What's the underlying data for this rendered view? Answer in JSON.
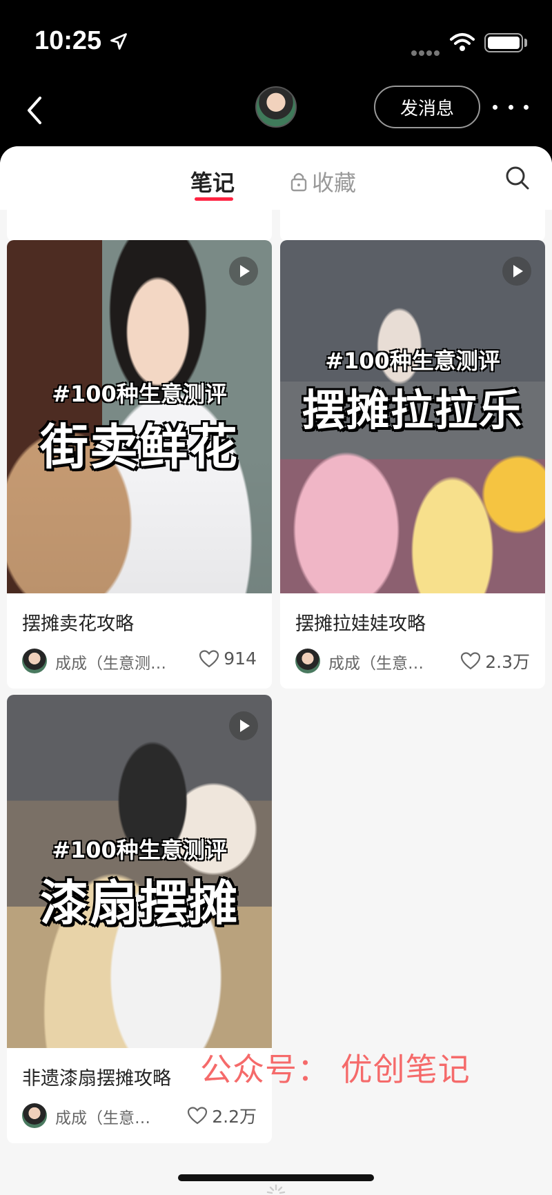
{
  "status_bar": {
    "time": "10:25"
  },
  "header": {
    "message_button": "发消息"
  },
  "tabs": {
    "notes": "笔记",
    "collections": "收藏"
  },
  "notes": [
    {
      "cover_tag": "#100种生意测评",
      "cover_title": "街卖鲜花",
      "title": "摆摊卖花攻略",
      "author": "成成（生意测…",
      "likes": "914"
    },
    {
      "cover_tag": "#100种生意测评",
      "cover_title": "摆摊拉拉乐",
      "title": "摆摊拉娃娃攻略",
      "author": "成成（生意…",
      "likes": "2.3万"
    },
    {
      "cover_tag": "#100种生意测评",
      "cover_title": "漆扇摆摊",
      "title": "非遗漆扇摆摊攻略",
      "author": "成成（生意…",
      "likes": "2.2万"
    }
  ],
  "watermark": "公众号：  优创笔记",
  "colors": {
    "accent": "#ff2442",
    "watermark": "#f56a6a"
  }
}
